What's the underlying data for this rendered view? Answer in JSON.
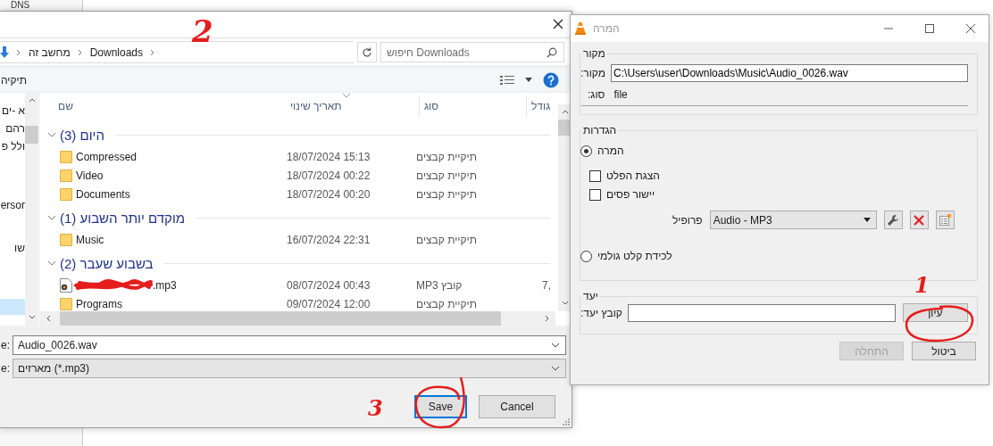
{
  "background_window": {
    "text": "DNS"
  },
  "file_dialog": {
    "breadcrumb": [
      "Downloads",
      "מחשב זה"
    ],
    "search": {
      "placeholder": "חיפוש Downloads"
    },
    "toolbar": {
      "new_folder": "תיקיה"
    },
    "nav_items": [
      {
        "label": "א -ים",
        "selected": false
      },
      {
        "label": "רהם",
        "selected": false
      },
      {
        "label": "ולל פ",
        "selected": false
      },
      {
        "label": "ersor",
        "selected": false
      },
      {
        "label": "שו",
        "selected": false
      },
      {
        "selected": true
      }
    ],
    "columns": [
      "גודל",
      "סוג",
      "תאריך שינוי",
      "שם"
    ],
    "groups": [
      {
        "title": "היום (3)",
        "expanded": true,
        "files": [
          {
            "name": "Compressed",
            "kind": "folder",
            "modified": "18/07/2024 15:13",
            "type": "תיקיית קבצים"
          },
          {
            "name": "Video",
            "kind": "folder",
            "modified": "18/07/2024 00:22",
            "type": "תיקיית קבצים"
          },
          {
            "name": "Documents",
            "kind": "folder",
            "modified": "18/07/2024 00:20",
            "type": "תיקיית קבצים"
          }
        ]
      },
      {
        "title": "מוקדם יותר השבוע (1)",
        "expanded": true,
        "files": [
          {
            "name": "Music",
            "kind": "folder",
            "modified": "16/07/2024 22:31",
            "type": "תיקיית קבצים"
          }
        ]
      },
      {
        "title": "בשבוע שעבר (2)",
        "expanded": true,
        "files": [
          {
            "name": ".mp3",
            "kind": "audio",
            "redacted": true,
            "modified": "08/07/2024 00:43",
            "type": "קובץ MP3",
            "size": "7,"
          },
          {
            "name": "Programs",
            "kind": "folder",
            "modified": "09/07/2024 12:00",
            "type": "תיקיית קבצים"
          }
        ]
      }
    ],
    "filename_label": "e:",
    "filename": "Audio_0026.wav",
    "filetype_label": "e:",
    "filetype": "מארזים (*.mp3)",
    "buttons": [
      {
        "label": "Cancel",
        "default": false
      },
      {
        "label": "Save",
        "default": true
      }
    ]
  },
  "convert_window": {
    "title": "המרה",
    "source": {
      "legend": "מקור",
      "label": "מקור:",
      "value": "C:\\Users\\user\\Downloads\\Music\\Audio_0026.wav",
      "type_label": "סוג:",
      "type_value": "file"
    },
    "settings": {
      "legend": "הגדרות",
      "options": [
        {
          "kind": "radio",
          "label": "המרה",
          "checked": true
        },
        {
          "kind": "checkbox",
          "label": "הצגת הפלט",
          "checked": false
        },
        {
          "kind": "checkbox",
          "label": "יישור פסים",
          "checked": false
        },
        {
          "kind": "profile",
          "label": "פרופיל",
          "value": "Audio - MP3"
        },
        {
          "kind": "radio",
          "label": "לכידת קלט גולמי",
          "checked": false
        }
      ]
    },
    "destination": {
      "legend": "יעד",
      "label": "קובץ יעד:",
      "browse": "עיון"
    },
    "buttons": [
      {
        "label": "ביטול",
        "disabled": false
      },
      {
        "label": "התחלה",
        "disabled": true
      }
    ]
  },
  "annotations": [
    {
      "label": "2"
    },
    {
      "label": "1"
    },
    {
      "label": "3"
    }
  ]
}
